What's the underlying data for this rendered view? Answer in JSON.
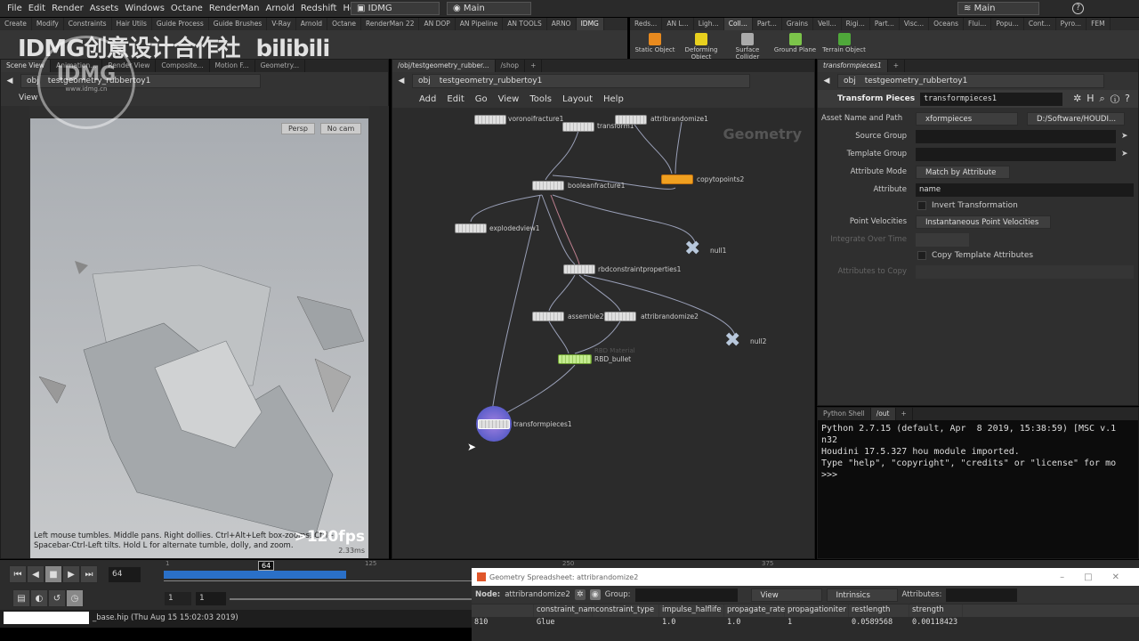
{
  "menu": [
    "File",
    "Edit",
    "Render",
    "Assets",
    "Windows",
    "Octane",
    "RenderMan",
    "Arnold",
    "Redshift",
    "Help"
  ],
  "desktop": "IDMG",
  "context": "Main",
  "context_right": "Main",
  "shelf_left_tabs": [
    "Create",
    "Modify",
    "Constraints",
    "Hair Utils",
    "Guide Process",
    "Guide Brushes",
    "V-Ray",
    "Arnold",
    "Octane",
    "RenderMan 22",
    "AN DOP",
    "AN Pipeline",
    "AN TOOLS",
    "ARNO",
    "IDMG"
  ],
  "shelf_right_tabs": [
    "Reds...",
    "AN L...",
    "Ligh...",
    "Coll...",
    "Part...",
    "Grains",
    "Vell...",
    "Rigi...",
    "Part...",
    "Visc...",
    "Oceans",
    "Flui...",
    "Popu...",
    "Cont...",
    "Pyro...",
    "FEM"
  ],
  "shelf_tools": [
    "Static Object",
    "Deforming Object",
    "Surface Collider",
    "Ground Plane",
    "Terrain Object"
  ],
  "watermark": {
    "text": "IDMG创意设计合作社",
    "brand": "bilibili",
    "url": "www.idmg.cn"
  },
  "viewport": {
    "tabs": [
      "Scene View",
      "Animation...",
      "Render View",
      "Composite...",
      "Motion F...",
      "Geometry..."
    ],
    "path_obj": "obj",
    "path_node": "testgeometry_rubbertoy1",
    "view_label": "View",
    "persp": "Persp",
    "cam": "No cam",
    "help1": "Left mouse tumbles. Middle pans. Right dollies. Ctrl+Alt+Left box-zooms. Ctrl+",
    "help2": "Spacebar-Ctrl-Left tilts. Hold L for alternate tumble, dolly, and zoom.",
    "fps": ">120fps",
    "ms": "2.33ms"
  },
  "network": {
    "tabs": [
      "/obj/testgeometry_rubber...",
      "/shop"
    ],
    "path_obj": "obj",
    "path_node": "testgeometry_rubbertoy1",
    "menu": [
      "Add",
      "Edit",
      "Go",
      "View",
      "Tools",
      "Layout",
      "Help"
    ],
    "context_label": "Geometry",
    "nodes": [
      "voronoifracture1",
      "transform1",
      "attribrandomize1",
      "copytopoints2",
      "booleanfracture1",
      "explodedview1",
      "null1",
      "rbdconstraintproperties1",
      "assemble2",
      "attribrandomize2",
      "null2",
      "RBD_bullet",
      "transformpieces1"
    ],
    "rbd_sub": "RBD Material"
  },
  "params": {
    "tab": "transformpieces1",
    "path_obj": "obj",
    "path_node": "testgeometry_rubbertoy1",
    "type": "Transform Pieces",
    "name": "transformpieces1",
    "asset_label": "Asset Name and Path",
    "asset": "xformpieces",
    "asset_path": "D:/Software/HOUDI...",
    "source_group": "Source Group",
    "template_group": "Template Group",
    "attr_mode_label": "Attribute Mode",
    "attr_mode": "Match by Attribute",
    "attribute_label": "Attribute",
    "attribute": "name",
    "invert": "Invert Transformation",
    "pv_label": "Point Velocities",
    "pv": "Instantaneous Point Velocities",
    "integrate": "Integrate Over Time",
    "copy_attr": "Copy Template Attributes",
    "attrs_to_copy": "Attributes to Copy"
  },
  "python": {
    "tabs": [
      "Python Shell",
      "/out"
    ],
    "lines": "Python 2.7.15 (default, Apr  8 2019, 15:38:59) [MSC v.1\nn32\nHoudini 17.5.327 hou module imported.\nType \"help\", \"copyright\", \"credits\" or \"license\" for mo\n>>>"
  },
  "timeline": {
    "frame": "64",
    "marker": "64",
    "ticks": [
      "1",
      "125",
      "250",
      "375"
    ],
    "start": "1",
    "end": "1",
    "progress": 0.33
  },
  "status": "_base.hip (Thu Aug 15 15:02:03 2019)",
  "spreadsheet": {
    "title": "Geometry Spreadsheet: attribrandomize2",
    "node_label": "Node:",
    "node": "attribrandomize2",
    "group_label": "Group:",
    "view": "View",
    "intrinsics": "Intrinsics",
    "attributes_label": "Attributes:",
    "columns": [
      "",
      "constraint_nam",
      "constraint_type",
      "impulse_halflife",
      "propagate_rate",
      "propagationiter",
      "restlength",
      "strength"
    ],
    "row": [
      "810",
      "Glue",
      "",
      "1.0",
      "1.0",
      "1",
      "0.0589568",
      "0.00118423"
    ]
  }
}
